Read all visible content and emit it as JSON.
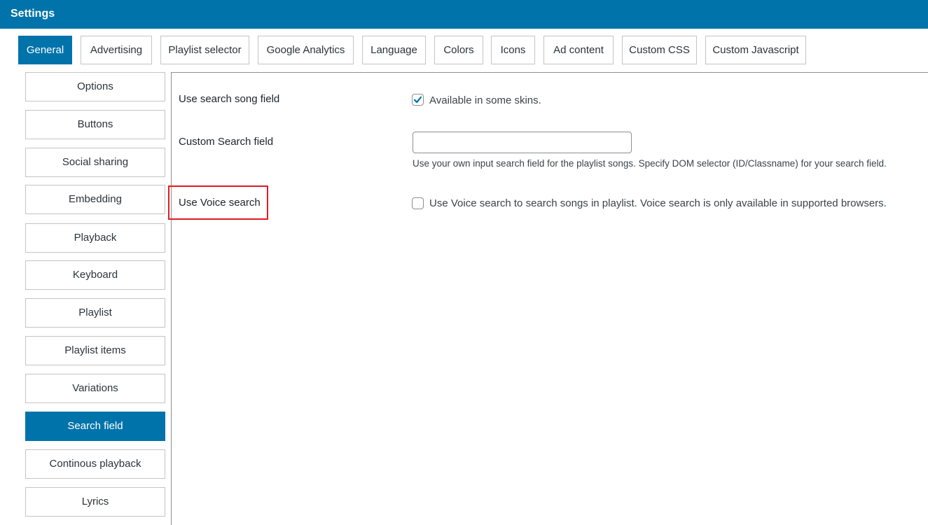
{
  "header": {
    "title": "Settings",
    "color": "#0073aa"
  },
  "tabs": [
    {
      "label": "General",
      "active": true
    },
    {
      "label": "Advertising",
      "active": false
    },
    {
      "label": "Playlist selector",
      "active": false
    },
    {
      "label": "Google Analytics",
      "active": false
    },
    {
      "label": "Language",
      "active": false
    },
    {
      "label": "Colors",
      "active": false
    },
    {
      "label": "Icons",
      "active": false
    },
    {
      "label": "Ad content",
      "active": false
    },
    {
      "label": "Custom CSS",
      "active": false
    },
    {
      "label": "Custom Javascript",
      "active": false
    }
  ],
  "sidebar": {
    "items": [
      {
        "label": "Options",
        "active": false
      },
      {
        "label": "Buttons",
        "active": false
      },
      {
        "label": "Social sharing",
        "active": false
      },
      {
        "label": "Embedding",
        "active": false
      },
      {
        "label": "Playback",
        "active": false
      },
      {
        "label": "Keyboard",
        "active": false
      },
      {
        "label": "Playlist",
        "active": false
      },
      {
        "label": "Playlist items",
        "active": false
      },
      {
        "label": "Variations",
        "active": false
      },
      {
        "label": "Search field",
        "active": true
      },
      {
        "label": "Continous playback",
        "active": false
      },
      {
        "label": "Lyrics",
        "active": false
      }
    ]
  },
  "fields": {
    "use_search_song": {
      "label": "Use search song field",
      "checked": true,
      "checkbox_text": "Available in some skins."
    },
    "custom_search": {
      "label": "Custom Search field",
      "value": "",
      "description": "Use your own input search field for the playlist songs. Specify DOM selector (ID/Classname) for your search field."
    },
    "use_voice_search": {
      "label": "Use Voice search",
      "checked": false,
      "checkbox_text": "Use Voice search to search songs in playlist. Voice search is only available in supported browsers."
    }
  },
  "colors": {
    "accent": "#0073aa",
    "highlight": "#e21b23"
  },
  "icons": {
    "checkmark": "checkmark-icon"
  }
}
